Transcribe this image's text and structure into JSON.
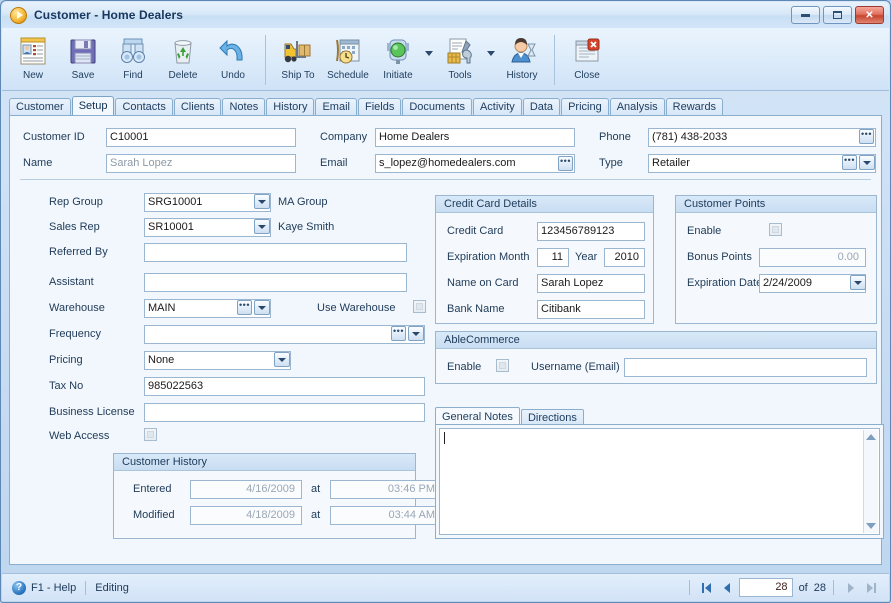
{
  "window": {
    "title": "Customer - Home Dealers",
    "app_icon": "play-circle-icon",
    "minimize_label": "Minimize",
    "maximize_label": "Maximize",
    "close_label": "Close"
  },
  "toolbar": {
    "items": [
      {
        "label": "New",
        "icon": "new-customer-icon"
      },
      {
        "label": "Save",
        "icon": "floppy-disk-icon"
      },
      {
        "label": "Find",
        "icon": "binoculars-icon"
      },
      {
        "label": "Delete",
        "icon": "recycle-bin-icon"
      },
      {
        "label": "Undo",
        "icon": "undo-arrow-icon"
      },
      {
        "label": "Ship To",
        "icon": "forklift-icon"
      },
      {
        "label": "Schedule",
        "icon": "calendar-clock-icon"
      },
      {
        "label": "Initiate",
        "icon": "traffic-light-icon"
      },
      {
        "label": "Tools",
        "icon": "tools-icon"
      },
      {
        "label": "History",
        "icon": "person-hourglass-icon"
      },
      {
        "label": "Close",
        "icon": "window-close-icon"
      }
    ]
  },
  "tabs": [
    {
      "label": "Customer",
      "active": false
    },
    {
      "label": "Setup",
      "active": true
    },
    {
      "label": "Contacts",
      "active": false
    },
    {
      "label": "Clients",
      "active": false
    },
    {
      "label": "Notes",
      "active": false
    },
    {
      "label": "History",
      "active": false
    },
    {
      "label": "Email",
      "active": false
    },
    {
      "label": "Fields",
      "active": false
    },
    {
      "label": "Documents",
      "active": false
    },
    {
      "label": "Activity",
      "active": false
    },
    {
      "label": "Data",
      "active": false
    },
    {
      "label": "Pricing",
      "active": false
    },
    {
      "label": "Analysis",
      "active": false
    },
    {
      "label": "Rewards",
      "active": false
    }
  ],
  "header": {
    "customer_id_label": "Customer ID",
    "customer_id_value": "C10001",
    "name_label": "Name",
    "name_value": "Sarah Lopez",
    "company_label": "Company",
    "company_value": "Home Dealers",
    "email_label": "Email",
    "email_value": "s_lopez@homedealers.com",
    "phone_label": "Phone",
    "phone_value": "(781) 438-2033",
    "type_label": "Type",
    "type_value": "Retailer"
  },
  "setup": {
    "rep_group_label": "Rep Group",
    "rep_group_value": "SRG10001",
    "rep_group_note": "MA Group",
    "sales_rep_label": "Sales Rep",
    "sales_rep_value": "SR10001",
    "sales_rep_note": "Kaye Smith",
    "referred_by_label": "Referred By",
    "referred_by_value": "",
    "assistant_label": "Assistant",
    "assistant_value": "",
    "warehouse_label": "Warehouse",
    "warehouse_value": "MAIN",
    "use_warehouse_label": "Use Warehouse",
    "use_warehouse_checked": false,
    "frequency_label": "Frequency",
    "frequency_value": "",
    "pricing_label": "Pricing",
    "pricing_value": "None",
    "tax_no_label": "Tax No",
    "tax_no_value": "985022563",
    "business_license_label": "Business License",
    "business_license_value": "",
    "web_access_label": "Web Access",
    "web_access_checked": false
  },
  "customer_history": {
    "title": "Customer History",
    "entered_label": "Entered",
    "entered_date": "4/16/2009",
    "entered_at_label": "at",
    "entered_time": "03:46 PM",
    "modified_label": "Modified",
    "modified_date": "4/18/2009",
    "modified_at_label": "at",
    "modified_time": "03:44 AM"
  },
  "credit_card": {
    "title": "Credit Card Details",
    "credit_card_label": "Credit Card",
    "credit_card_value": "123456789123",
    "expiration_month_label": "Expiration Month",
    "expiration_month_value": "11",
    "year_label": "Year",
    "year_value": "2010",
    "name_on_card_label": "Name on Card",
    "name_on_card_value": "Sarah Lopez",
    "bank_name_label": "Bank Name",
    "bank_name_value": "Citibank"
  },
  "customer_points": {
    "title": "Customer Points",
    "enable_label": "Enable",
    "enable_checked": false,
    "bonus_points_label": "Bonus Points",
    "bonus_points_value": "0.00",
    "expiration_date_label": "Expiration Date",
    "expiration_date_value": "2/24/2009"
  },
  "able_commerce": {
    "title": "AbleCommerce",
    "enable_label": "Enable",
    "enable_checked": false,
    "username_label": "Username (Email)",
    "username_value": ""
  },
  "notes": {
    "tabs": [
      {
        "label": "General Notes",
        "active": true
      },
      {
        "label": "Directions",
        "active": false
      }
    ],
    "content": ""
  },
  "statusbar": {
    "help_icon": "help-circle-icon",
    "help_label": "F1 - Help",
    "mode_label": "Editing",
    "record_current": "28",
    "record_of_label": "of",
    "record_total": "28"
  },
  "colors": {
    "accent": "#1d3a5a",
    "panel_bg": "#f1f7fd",
    "group_header": "#d9e9f8",
    "close_button": "#c6452f",
    "link": "#23538f"
  }
}
